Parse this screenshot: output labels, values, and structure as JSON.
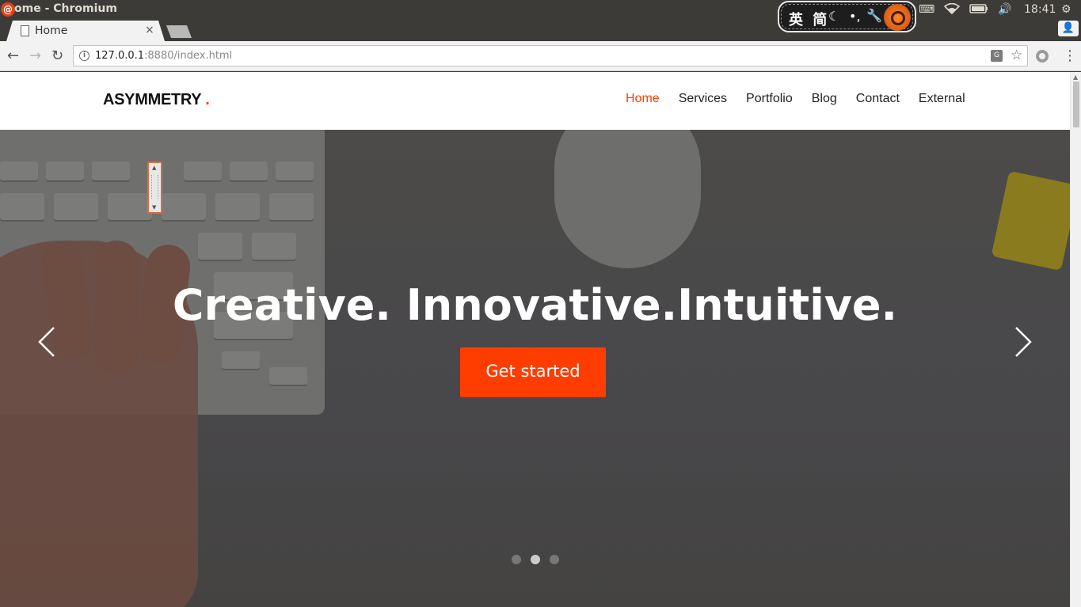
{
  "os": {
    "window_title": "ome - Chromium",
    "ime_text": "英 简",
    "clock": "18:41"
  },
  "browser": {
    "tab_title": "Home",
    "tab_close": "×",
    "url_host": "127.0.0.1",
    "url_rest": ":8880/index.html"
  },
  "site": {
    "brand": "ASYMMETRY",
    "brand_dot": ".",
    "nav": [
      {
        "label": "Home",
        "active": true
      },
      {
        "label": "Services"
      },
      {
        "label": "Portfolio"
      },
      {
        "label": "Blog"
      },
      {
        "label": "Contact"
      },
      {
        "label": "External"
      }
    ],
    "hero": {
      "title": "Creative. Innovative.Intuitive.",
      "cta": "Get started",
      "active_slide": 2,
      "slide_count": 3
    }
  },
  "colors": {
    "accent": "#ff3d00"
  }
}
